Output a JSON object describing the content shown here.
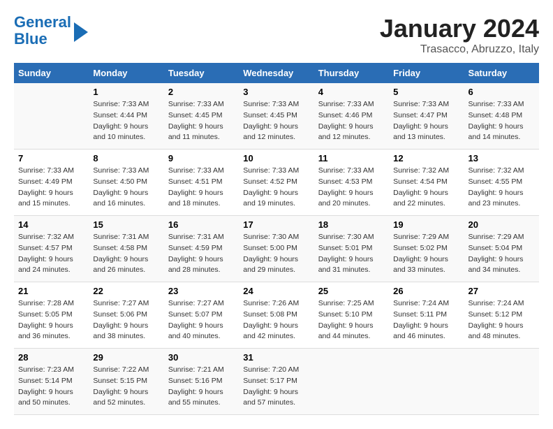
{
  "header": {
    "logo_line1": "General",
    "logo_line2": "Blue",
    "title": "January 2024",
    "subtitle": "Trasacco, Abruzzo, Italy"
  },
  "days_of_week": [
    "Sunday",
    "Monday",
    "Tuesday",
    "Wednesday",
    "Thursday",
    "Friday",
    "Saturday"
  ],
  "weeks": [
    [
      {
        "day": "",
        "info": ""
      },
      {
        "day": "1",
        "info": "Sunrise: 7:33 AM\nSunset: 4:44 PM\nDaylight: 9 hours\nand 10 minutes."
      },
      {
        "day": "2",
        "info": "Sunrise: 7:33 AM\nSunset: 4:45 PM\nDaylight: 9 hours\nand 11 minutes."
      },
      {
        "day": "3",
        "info": "Sunrise: 7:33 AM\nSunset: 4:45 PM\nDaylight: 9 hours\nand 12 minutes."
      },
      {
        "day": "4",
        "info": "Sunrise: 7:33 AM\nSunset: 4:46 PM\nDaylight: 9 hours\nand 12 minutes."
      },
      {
        "day": "5",
        "info": "Sunrise: 7:33 AM\nSunset: 4:47 PM\nDaylight: 9 hours\nand 13 minutes."
      },
      {
        "day": "6",
        "info": "Sunrise: 7:33 AM\nSunset: 4:48 PM\nDaylight: 9 hours\nand 14 minutes."
      }
    ],
    [
      {
        "day": "7",
        "info": "Sunrise: 7:33 AM\nSunset: 4:49 PM\nDaylight: 9 hours\nand 15 minutes."
      },
      {
        "day": "8",
        "info": "Sunrise: 7:33 AM\nSunset: 4:50 PM\nDaylight: 9 hours\nand 16 minutes."
      },
      {
        "day": "9",
        "info": "Sunrise: 7:33 AM\nSunset: 4:51 PM\nDaylight: 9 hours\nand 18 minutes."
      },
      {
        "day": "10",
        "info": "Sunrise: 7:33 AM\nSunset: 4:52 PM\nDaylight: 9 hours\nand 19 minutes."
      },
      {
        "day": "11",
        "info": "Sunrise: 7:33 AM\nSunset: 4:53 PM\nDaylight: 9 hours\nand 20 minutes."
      },
      {
        "day": "12",
        "info": "Sunrise: 7:32 AM\nSunset: 4:54 PM\nDaylight: 9 hours\nand 22 minutes."
      },
      {
        "day": "13",
        "info": "Sunrise: 7:32 AM\nSunset: 4:55 PM\nDaylight: 9 hours\nand 23 minutes."
      }
    ],
    [
      {
        "day": "14",
        "info": "Sunrise: 7:32 AM\nSunset: 4:57 PM\nDaylight: 9 hours\nand 24 minutes."
      },
      {
        "day": "15",
        "info": "Sunrise: 7:31 AM\nSunset: 4:58 PM\nDaylight: 9 hours\nand 26 minutes."
      },
      {
        "day": "16",
        "info": "Sunrise: 7:31 AM\nSunset: 4:59 PM\nDaylight: 9 hours\nand 28 minutes."
      },
      {
        "day": "17",
        "info": "Sunrise: 7:30 AM\nSunset: 5:00 PM\nDaylight: 9 hours\nand 29 minutes."
      },
      {
        "day": "18",
        "info": "Sunrise: 7:30 AM\nSunset: 5:01 PM\nDaylight: 9 hours\nand 31 minutes."
      },
      {
        "day": "19",
        "info": "Sunrise: 7:29 AM\nSunset: 5:02 PM\nDaylight: 9 hours\nand 33 minutes."
      },
      {
        "day": "20",
        "info": "Sunrise: 7:29 AM\nSunset: 5:04 PM\nDaylight: 9 hours\nand 34 minutes."
      }
    ],
    [
      {
        "day": "21",
        "info": "Sunrise: 7:28 AM\nSunset: 5:05 PM\nDaylight: 9 hours\nand 36 minutes."
      },
      {
        "day": "22",
        "info": "Sunrise: 7:27 AM\nSunset: 5:06 PM\nDaylight: 9 hours\nand 38 minutes."
      },
      {
        "day": "23",
        "info": "Sunrise: 7:27 AM\nSunset: 5:07 PM\nDaylight: 9 hours\nand 40 minutes."
      },
      {
        "day": "24",
        "info": "Sunrise: 7:26 AM\nSunset: 5:08 PM\nDaylight: 9 hours\nand 42 minutes."
      },
      {
        "day": "25",
        "info": "Sunrise: 7:25 AM\nSunset: 5:10 PM\nDaylight: 9 hours\nand 44 minutes."
      },
      {
        "day": "26",
        "info": "Sunrise: 7:24 AM\nSunset: 5:11 PM\nDaylight: 9 hours\nand 46 minutes."
      },
      {
        "day": "27",
        "info": "Sunrise: 7:24 AM\nSunset: 5:12 PM\nDaylight: 9 hours\nand 48 minutes."
      }
    ],
    [
      {
        "day": "28",
        "info": "Sunrise: 7:23 AM\nSunset: 5:14 PM\nDaylight: 9 hours\nand 50 minutes."
      },
      {
        "day": "29",
        "info": "Sunrise: 7:22 AM\nSunset: 5:15 PM\nDaylight: 9 hours\nand 52 minutes."
      },
      {
        "day": "30",
        "info": "Sunrise: 7:21 AM\nSunset: 5:16 PM\nDaylight: 9 hours\nand 55 minutes."
      },
      {
        "day": "31",
        "info": "Sunrise: 7:20 AM\nSunset: 5:17 PM\nDaylight: 9 hours\nand 57 minutes."
      },
      {
        "day": "",
        "info": ""
      },
      {
        "day": "",
        "info": ""
      },
      {
        "day": "",
        "info": ""
      }
    ]
  ]
}
